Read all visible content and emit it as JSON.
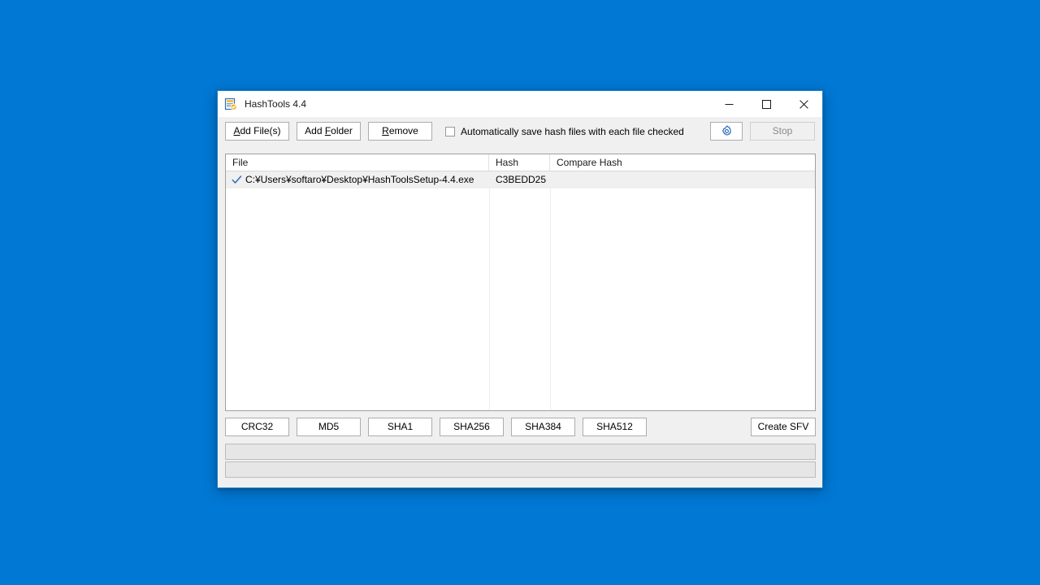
{
  "window": {
    "title": "HashTools 4.4",
    "icon": "hashtools-document-check-icon",
    "caption": {
      "minimize": "minimize-icon",
      "maximize": "maximize-icon",
      "close": "close-icon"
    }
  },
  "toolbar": {
    "add_files": {
      "pre": "A",
      "rest": "dd File(s)"
    },
    "add_folder": {
      "pre": "Add ",
      "accel": "F",
      "rest": "older"
    },
    "remove": {
      "pre": "R",
      "rest": "emove"
    },
    "autosave_label": "Automatically save hash files with each file checked",
    "autosave_checked": false,
    "settings_icon": "gear-icon",
    "stop_label": "Stop",
    "stop_disabled": true
  },
  "listview": {
    "columns": [
      {
        "label": "File"
      },
      {
        "label": "Hash"
      },
      {
        "label": "Compare Hash"
      }
    ],
    "rows": [
      {
        "checked": true,
        "file": "C:¥Users¥softaro¥Desktop¥HashToolsSetup-4.4.exe",
        "hash": "C3BEDD25",
        "compare": ""
      }
    ]
  },
  "algorithms": [
    {
      "label": "CRC32"
    },
    {
      "label": "MD5"
    },
    {
      "label": "SHA1"
    },
    {
      "label": "SHA256"
    },
    {
      "label": "SHA384"
    },
    {
      "label": "SHA512"
    }
  ],
  "create_sfv_label": "Create SFV",
  "colors": {
    "desktop": "#0078d4",
    "window_border": "#1883c9",
    "accent_check": "#2b6fb5",
    "gear_blue": "#1e63b5",
    "chrome": "#f0f0f0"
  }
}
